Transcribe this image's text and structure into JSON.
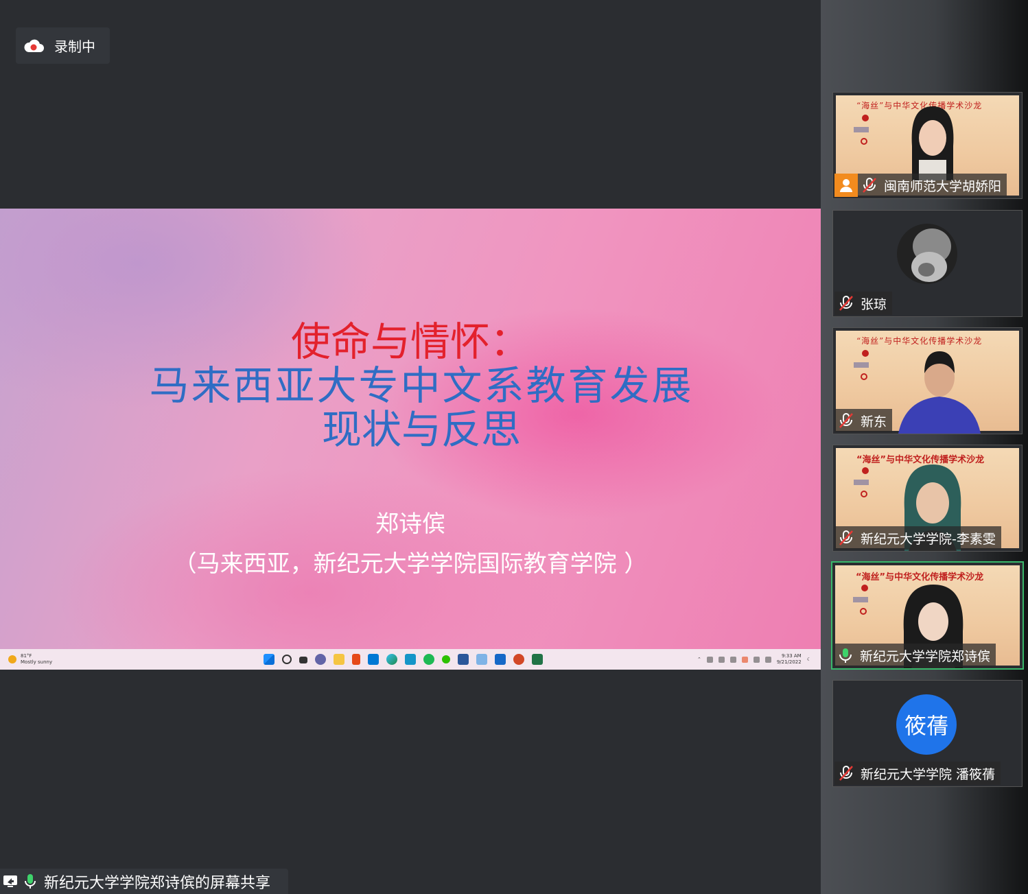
{
  "recording": {
    "label": "录制中"
  },
  "slide": {
    "title_red": "使命与情怀：",
    "title_blue_line1": "马来西亚大专中文系教育发展",
    "title_blue_line2": "现状与反思",
    "author": "郑诗傧",
    "affiliation": "（马来西亚，新纪元大学学院国际教育学院 ）"
  },
  "taskbar": {
    "weather_temp": "81°F",
    "weather_desc": "Mostly sunny",
    "time": "9:33 AM",
    "date": "9/21/2022",
    "apps": [
      "start-icon",
      "search-icon",
      "task-view-icon",
      "chat-icon",
      "file-explorer-icon",
      "office-icon",
      "mail-icon",
      "edge-icon",
      "l-app-icon",
      "spotify-icon",
      "wechat-icon",
      "word-icon",
      "snipping-icon",
      "whiteboard-icon",
      "powerpoint-icon",
      "excel-icon"
    ]
  },
  "share_bar": {
    "label": "新纪元大学学院郑诗傧的屏幕共享"
  },
  "participants": [
    {
      "name": "闽南师范大学胡娇阳",
      "banner": "“海丝”与中华文化传播学术沙龙",
      "muted": true,
      "host_icon": true
    },
    {
      "name": "张琼",
      "muted": true,
      "avatar": "lion-photo"
    },
    {
      "name": "新东",
      "banner": "“海丝”与中华文化传播学术沙龙",
      "muted": true
    },
    {
      "name": "新纪元大学学院-李素雯",
      "banner": "“海丝”与中华文化传播学术沙龙",
      "muted": true
    },
    {
      "name": "新纪元大学学院郑诗傧",
      "banner": "“海丝”与中华文化传播学术沙龙",
      "muted": false,
      "speaking": true
    },
    {
      "name": "新纪元大学学院 潘筱蒨",
      "muted": true,
      "avatar_text": "筱蒨"
    }
  ],
  "colors": {
    "accent_speaking": "#39b86b",
    "avatar_blue": "#1f74ea",
    "host_orange": "#f28b1e",
    "title_red": "#e3212c",
    "title_blue": "#2f6dc4"
  }
}
